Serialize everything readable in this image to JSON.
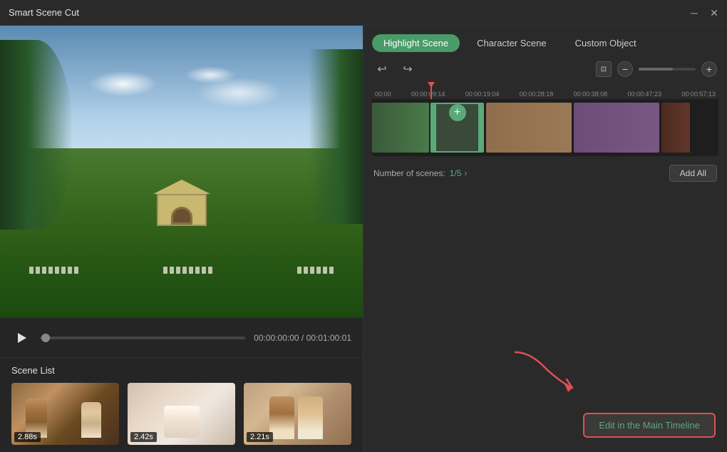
{
  "titlebar": {
    "title": "Smart Scene Cut",
    "minimize_label": "minimize",
    "close_label": "close"
  },
  "tabs": {
    "highlight": "Highlight Scene",
    "character": "Character Scene",
    "custom": "Custom Object",
    "active": "highlight"
  },
  "timeline": {
    "ruler_times": [
      "00:00",
      "00:00:09:14",
      "00:00:19:04",
      "00:00:28:18",
      "00:00:38:08",
      "00:00:47:23",
      "00:00:57:13"
    ],
    "scene_count_label": "Number of scenes:",
    "scene_count_value": "1/5",
    "add_all_label": "Add All"
  },
  "playback": {
    "current_time": "00:00:00:00",
    "separator": "/",
    "total_time": "00:01:00:01"
  },
  "scene_list": {
    "title": "Scene List",
    "scenes": [
      {
        "duration": "2.88s"
      },
      {
        "duration": "2.42s"
      },
      {
        "duration": "2.21s"
      }
    ]
  },
  "actions": {
    "edit_main_timeline": "Edit in the Main Timeline"
  },
  "icons": {
    "undo": "↩",
    "redo": "↪",
    "fit": "⊡",
    "zoom_out": "−",
    "zoom_in": "+",
    "play": "▶",
    "plus_circle": "＋",
    "chevron_right": "›"
  }
}
